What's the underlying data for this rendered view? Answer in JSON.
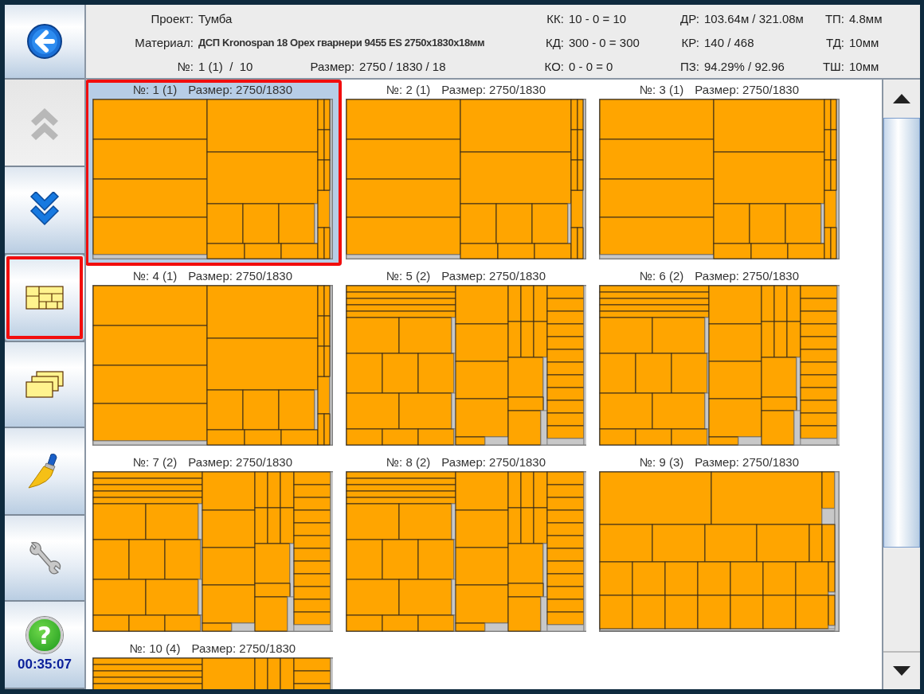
{
  "sidebar": {
    "buttons": [
      {
        "kind": "back",
        "selected": false,
        "disabled": false
      },
      {
        "kind": "up",
        "selected": false,
        "disabled": true
      },
      {
        "kind": "down",
        "selected": false,
        "disabled": false
      },
      {
        "kind": "layout",
        "selected": true,
        "disabled": false
      },
      {
        "kind": "sheets",
        "selected": false,
        "disabled": false
      },
      {
        "kind": "brush",
        "selected": false,
        "disabled": false
      },
      {
        "kind": "wrench",
        "selected": false,
        "disabled": false
      },
      {
        "kind": "help",
        "selected": false,
        "disabled": false,
        "glyph": "?"
      }
    ],
    "timer": "00:35:07"
  },
  "header": {
    "rows": [
      [
        {
          "label": "Проект:",
          "value": "Тумба"
        },
        {
          "label": "КК:",
          "value": "10 - 0 = 10"
        },
        {
          "label": "ДР:",
          "value": "103.64м / 321.08м"
        },
        {
          "label": "ТП:",
          "value": "4.8мм"
        }
      ],
      [
        {
          "label": "Материал:",
          "value": "ДСП Kronospan 18 Орех гварнери 9455 ES 2750x1830x18мм"
        },
        {
          "label": "КД:",
          "value": "300 - 0 = 300"
        },
        {
          "label": "КР:",
          "value": "140 / 468"
        },
        {
          "label": "ТД:",
          "value": "10мм"
        }
      ],
      [
        {
          "label": "№:",
          "value": "1 (1)  /  10",
          "extra": {
            "label": "Размер:",
            "value": "2750 / 1830 / 18"
          }
        },
        {
          "label": "КО:",
          "value": "0 - 0 = 0"
        },
        {
          "label": "ПЗ:",
          "value": "94.29% / 92.96"
        },
        {
          "label": "ТШ:",
          "value": "10мм"
        }
      ]
    ]
  },
  "sheets": [
    {
      "number": "№: 1 (1)",
      "size": "Размер: 2750/1830",
      "selected": true,
      "kind": "a"
    },
    {
      "number": "№: 2 (1)",
      "size": "Размер: 2750/1830",
      "selected": false,
      "kind": "a"
    },
    {
      "number": "№: 3 (1)",
      "size": "Размер: 2750/1830",
      "selected": false,
      "kind": "a"
    },
    {
      "number": "№: 4 (1)",
      "size": "Размер: 2750/1830",
      "selected": false,
      "kind": "a"
    },
    {
      "number": "№: 5 (2)",
      "size": "Размер: 2750/1830",
      "selected": false,
      "kind": "b"
    },
    {
      "number": "№: 6 (2)",
      "size": "Размер: 2750/1830",
      "selected": false,
      "kind": "b"
    },
    {
      "number": "№: 7 (2)",
      "size": "Размер: 2750/1830",
      "selected": false,
      "kind": "b"
    },
    {
      "number": "№: 8 (2)",
      "size": "Размер: 2750/1830",
      "selected": false,
      "kind": "b"
    },
    {
      "number": "№: 9 (3)",
      "size": "Размер: 2750/1830",
      "selected": false,
      "kind": "c"
    },
    {
      "number": "№: 10 (4)",
      "size": "Размер: 2750/1830",
      "selected": false,
      "kind": "b"
    }
  ]
}
